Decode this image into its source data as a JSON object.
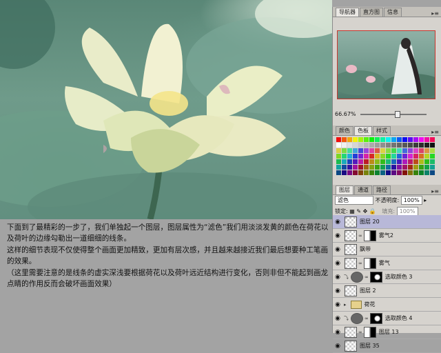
{
  "navigator": {
    "tabs": [
      "导航器",
      "直方图",
      "信息"
    ],
    "zoom": "66.67%"
  },
  "color_panel": {
    "tabs": [
      "颜色",
      "色板",
      "样式"
    ]
  },
  "layers_panel": {
    "tabs": [
      "图层",
      "通道",
      "路径"
    ],
    "blend_mode": "滤色",
    "opacity_label": "不透明度:",
    "opacity_value": "100%",
    "lock_label": "锁定:",
    "fill_label": "填充:",
    "fill_value": "100%",
    "layers": [
      {
        "name": "图层 20",
        "selected": true,
        "kind": "layer"
      },
      {
        "name": "雾气2",
        "selected": false,
        "kind": "mask"
      },
      {
        "name": "飘带",
        "selected": false,
        "kind": "layer"
      },
      {
        "name": "雾气",
        "selected": false,
        "kind": "mask"
      },
      {
        "name": "选取颜色 3",
        "selected": false,
        "kind": "adjust"
      },
      {
        "name": "图层 2",
        "selected": false,
        "kind": "layer"
      },
      {
        "name": "荷花",
        "selected": false,
        "kind": "group"
      },
      {
        "name": "选取颜色 4",
        "selected": false,
        "kind": "adjust"
      },
      {
        "name": "图层 13",
        "selected": false,
        "kind": "mask"
      },
      {
        "name": "图层 35",
        "selected": false,
        "kind": "layer"
      }
    ]
  },
  "article": {
    "p1": "下面到了最精彩的一步了，我们单独起一个图层，图层属性为“滤色”我们用淡淡发黄的颜色在荷花以及荷叶的边缘勾勒出一道细细的线条。",
    "p2": "这样的细节表现不仅使得整个画面更加精致，更加有层次感，并且越来越接近我们最后想要种工笔画的效果。",
    "p3": "（这里需要注意的是线条的虚实深浅要根据荷花以及荷叶远近结构进行变化，否则非但不能起到画龙点睛的作用反而会破坏画面效果）"
  },
  "colors": {
    "panel_bg": "#d6d3ce",
    "page_bg": "#a3a3a3",
    "selection": "#b8b8d8",
    "nav_frame": "#c8352c"
  }
}
